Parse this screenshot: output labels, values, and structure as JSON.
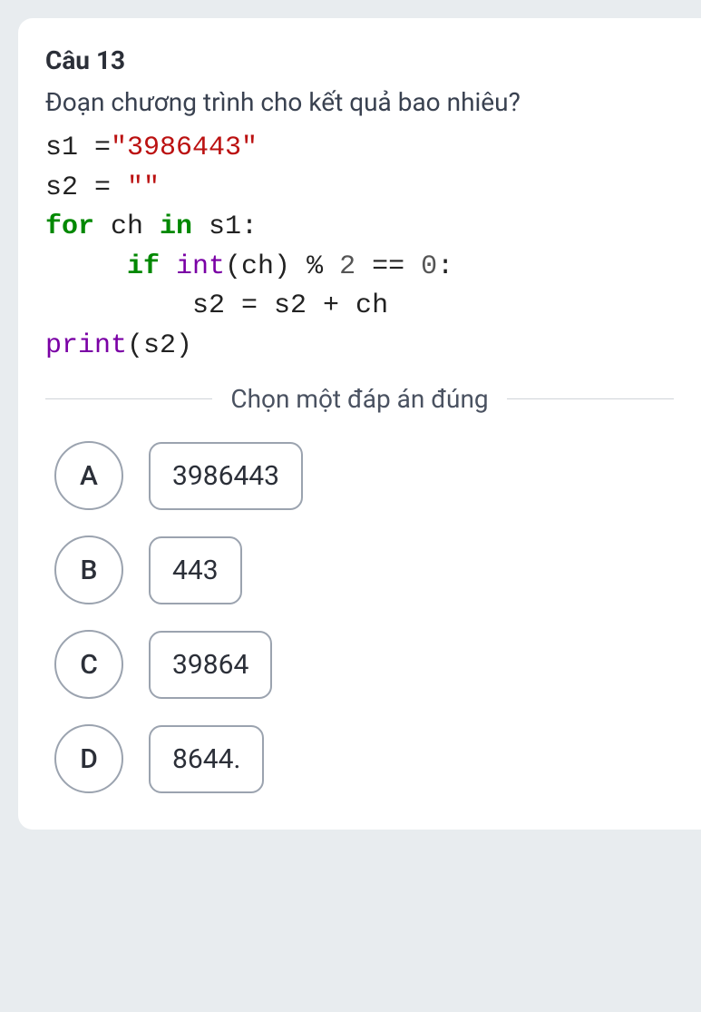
{
  "question": {
    "label": "Câu 13",
    "text": "Đoạn chương trình cho kết quả bao nhiêu?"
  },
  "code": {
    "s1_lhs": "s1 ",
    "eq": "=",
    "s1_str": "\"3986443\"",
    "s2_lhs": "s2 ",
    "s2_eq": "= ",
    "s2_str": "\"\"",
    "for": "for",
    "ch": " ch ",
    "in": "in",
    "s1_colon": " s1:",
    "indent1": "     ",
    "if": "if",
    "int_fn": " int",
    "int_arg": "(ch) ",
    "mod": "% ",
    "two": "2",
    "eqeq": " == ",
    "zero": "0",
    "colon": ":",
    "indent2": "         ",
    "s2_assign": "s2 = s2 + ch",
    "print_fn": "print",
    "print_arg": "(s2)"
  },
  "prompt": "Chọn một đáp án đúng",
  "options": [
    {
      "letter": "A",
      "value": "3986443"
    },
    {
      "letter": "B",
      "value": "443"
    },
    {
      "letter": "C",
      "value": "39864"
    },
    {
      "letter": "D",
      "value": "8644."
    }
  ]
}
